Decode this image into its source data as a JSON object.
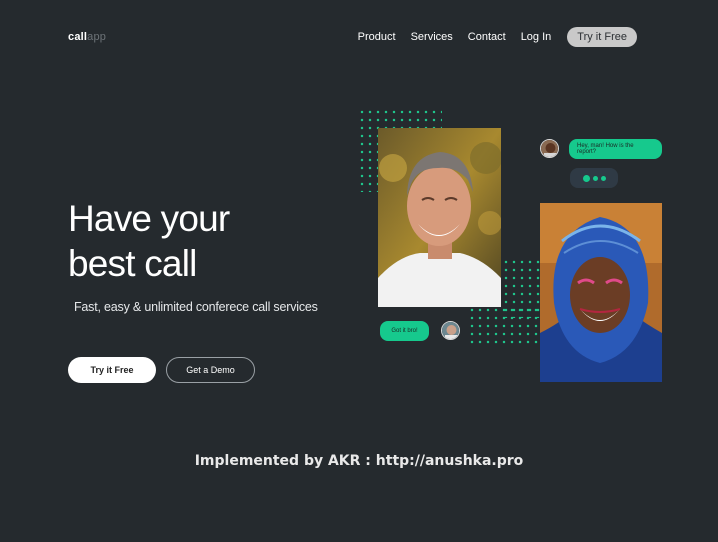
{
  "header": {
    "logo_strong": "call",
    "logo_light": "app",
    "nav": [
      "Product",
      "Services",
      "Contact",
      "Log In"
    ],
    "cta": "Try it Free"
  },
  "hero": {
    "title_line1": "Have your",
    "title_line2": "best call",
    "subtitle": "Fast, easy & unlimited conferece call services",
    "primary_button": "Try it Free",
    "secondary_button": "Get a Demo"
  },
  "chat": {
    "incoming_message": "Hey, man! How is the report?",
    "outgoing_message": "Got it bro!"
  },
  "footer": {
    "credit": "Implemented by AKR : http://anushka.pro"
  },
  "colors": {
    "background": "#252a2e",
    "accent": "#16c98d",
    "dots": "#1fc48b"
  }
}
